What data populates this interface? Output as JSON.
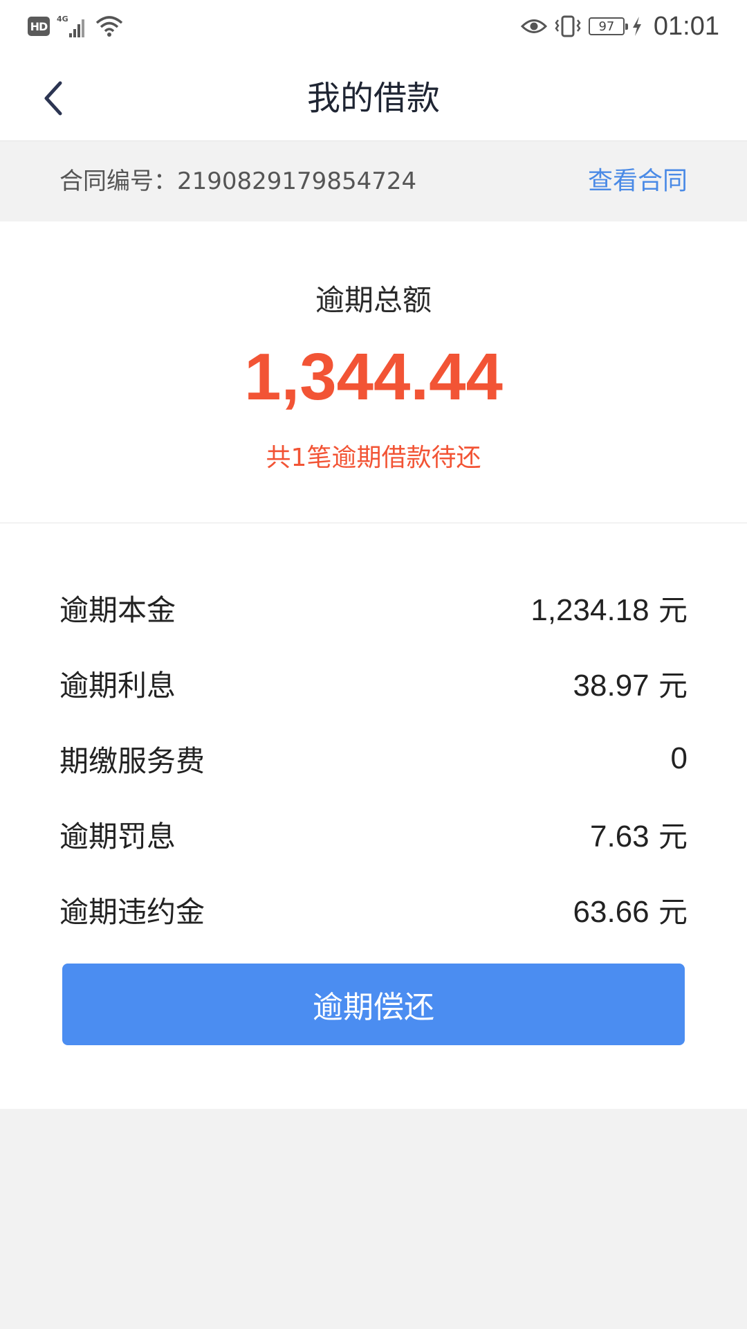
{
  "status_bar": {
    "left_icons": [
      "hd-icon",
      "signal-4g-icon",
      "wifi-icon"
    ],
    "hd_label": "HD",
    "battery_level": "97",
    "time": "01:01"
  },
  "header": {
    "title": "我的借款",
    "back_icon": "chevron-left-icon"
  },
  "contract": {
    "label": "合同编号：2190829179854724",
    "view_link": "查看合同"
  },
  "summary": {
    "title": "逾期总额",
    "amount": "1,344.44",
    "note": "共1笔逾期借款待还"
  },
  "details": {
    "rows": [
      {
        "label": "逾期本金",
        "value": "1,234.18",
        "unit": " 元"
      },
      {
        "label": "逾期利息",
        "value": "38.97",
        "unit": " 元"
      },
      {
        "label": "期缴服务费",
        "value": "0",
        "unit": ""
      },
      {
        "label": "逾期罚息",
        "value": "7.63",
        "unit": " 元"
      },
      {
        "label": "逾期违约金",
        "value": "63.66",
        "unit": " 元"
      }
    ]
  },
  "actions": {
    "repay_label": "逾期偿还"
  },
  "colors": {
    "accent_blue": "#4b8df1",
    "link_blue": "#4a8ae6",
    "amount_red": "#f25435"
  }
}
